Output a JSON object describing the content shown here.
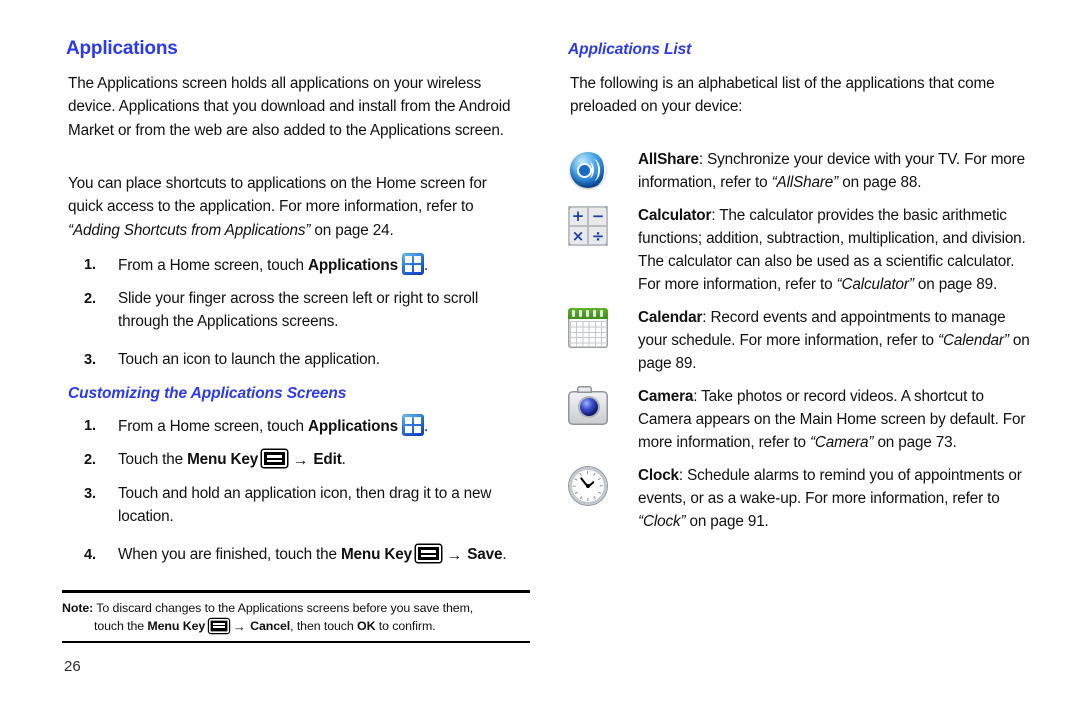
{
  "document": {
    "page_number": "26"
  },
  "left_column": {
    "heading": "Applications",
    "paragraph_1": "The Applications screen holds all applications on your wireless device. Applications that you download and install from the Android Market or from the web are also added to the Applications screen.",
    "paragraph_2_pre": "You can place shortcuts to applications on the Home screen for quick access to the application. For more information, refer to ",
    "paragraph_2_italic": "“Adding Shortcuts from Applications”",
    "paragraph_2_post": " on page 24.",
    "steps_1": [
      {
        "number": "1.",
        "text_pre": "From a Home screen, touch ",
        "bold": "Applications",
        "icon": "applications-grid-icon",
        "text_post": "."
      },
      {
        "number": "2.",
        "text_pre": "Slide your finger across the screen left or right to scroll through the Applications screens.",
        "bold": "",
        "text_post": ""
      },
      {
        "number": "3.",
        "text_pre": "Touch an icon to launch the application.",
        "bold": "",
        "text_post": ""
      }
    ],
    "subheading": "Customizing the Applications Screens",
    "steps_2": [
      {
        "number": "1.",
        "text_pre": "From a Home screen, touch ",
        "bold": "Applications",
        "icon": "applications-grid-icon",
        "text_post": "."
      },
      {
        "number": "2.",
        "text_pre": "Touch the ",
        "bold": "Menu Key",
        "icon": "menu-key-icon",
        "arrow": "→",
        "bold2": "Edit",
        "text_post": "."
      },
      {
        "number": "3.",
        "text_pre": "Touch and hold an application icon, then drag it to a new location.",
        "bold": "",
        "text_post": ""
      },
      {
        "number": "4.",
        "text_pre": "When you are finished, touch the ",
        "bold": "Menu Key",
        "icon": "menu-key-icon",
        "arrow": "→",
        "bold2": "Save",
        "text_post": "."
      }
    ],
    "note": {
      "label": "Note:",
      "line1": "To discard changes to the Applications screens before you save them,",
      "line2_pre": "touch the ",
      "line2_bold": "Menu Key",
      "line2_arrow": "→",
      "line2_bold2": "Cancel",
      "line2_mid": ", then touch ",
      "line2_bold3": "OK",
      "line2_post": " to confirm."
    }
  },
  "right_column": {
    "heading": "Applications List",
    "intro": "The following is an alphabetical list of the applications that come preloaded on your device:",
    "apps": [
      {
        "icon": "allshare-icon",
        "name": "AllShare",
        "desc_pre": ": Synchronize your device with your TV. For more information, refer to ",
        "ref": "“AllShare”",
        "desc_post": " on page 88."
      },
      {
        "icon": "calculator-icon",
        "name": "Calculator",
        "desc_pre": ": The calculator provides the basic arithmetic functions; addition, subtraction, multiplication, and division. The calculator can also be used as a scientific calculator. For more information, refer to ",
        "ref": "“Calculator”",
        "desc_post": " on page 89."
      },
      {
        "icon": "calendar-icon",
        "name": "Calendar",
        "desc_pre": ": Record events and appointments to manage your schedule. For more information, refer to ",
        "ref": "“Calendar”",
        "desc_post": " on page 89."
      },
      {
        "icon": "camera-icon",
        "name": "Camera",
        "desc_pre": ": Take photos or record videos. A shortcut to Camera appears on the Main Home screen by default. For more information, refer to ",
        "ref": "“Camera”",
        "desc_post": " on page 73."
      },
      {
        "icon": "clock-icon",
        "name": "Clock",
        "desc_pre": ": Schedule alarms to remind you of appointments or events, or as a wake-up. For more information, refer to ",
        "ref": "“Clock”",
        "desc_post": " on page 91."
      }
    ],
    "calculator_icon_symbols": [
      "+",
      "−",
      "×",
      "÷"
    ]
  },
  "colors": {
    "heading_blue": "#2b39ef",
    "text_black": "#111111",
    "calendar_green": "#4fa31e"
  }
}
